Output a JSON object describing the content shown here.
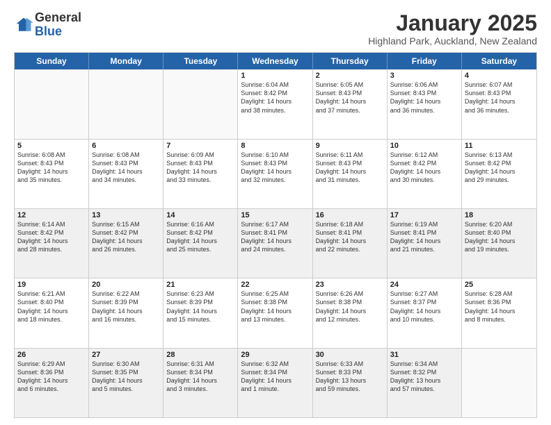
{
  "logo": {
    "general": "General",
    "blue": "Blue"
  },
  "header": {
    "month_title": "January 2025",
    "location": "Highland Park, Auckland, New Zealand"
  },
  "days_of_week": [
    "Sunday",
    "Monday",
    "Tuesday",
    "Wednesday",
    "Thursday",
    "Friday",
    "Saturday"
  ],
  "weeks": [
    [
      {
        "day": "",
        "text": "",
        "empty": true
      },
      {
        "day": "",
        "text": "",
        "empty": true
      },
      {
        "day": "",
        "text": "",
        "empty": true
      },
      {
        "day": "1",
        "text": "Sunrise: 6:04 AM\nSunset: 8:42 PM\nDaylight: 14 hours\nand 38 minutes."
      },
      {
        "day": "2",
        "text": "Sunrise: 6:05 AM\nSunset: 8:43 PM\nDaylight: 14 hours\nand 37 minutes."
      },
      {
        "day": "3",
        "text": "Sunrise: 6:06 AM\nSunset: 8:43 PM\nDaylight: 14 hours\nand 36 minutes."
      },
      {
        "day": "4",
        "text": "Sunrise: 6:07 AM\nSunset: 8:43 PM\nDaylight: 14 hours\nand 36 minutes."
      }
    ],
    [
      {
        "day": "5",
        "text": "Sunrise: 6:08 AM\nSunset: 8:43 PM\nDaylight: 14 hours\nand 35 minutes."
      },
      {
        "day": "6",
        "text": "Sunrise: 6:08 AM\nSunset: 8:43 PM\nDaylight: 14 hours\nand 34 minutes."
      },
      {
        "day": "7",
        "text": "Sunrise: 6:09 AM\nSunset: 8:43 PM\nDaylight: 14 hours\nand 33 minutes."
      },
      {
        "day": "8",
        "text": "Sunrise: 6:10 AM\nSunset: 8:43 PM\nDaylight: 14 hours\nand 32 minutes."
      },
      {
        "day": "9",
        "text": "Sunrise: 6:11 AM\nSunset: 8:43 PM\nDaylight: 14 hours\nand 31 minutes."
      },
      {
        "day": "10",
        "text": "Sunrise: 6:12 AM\nSunset: 8:42 PM\nDaylight: 14 hours\nand 30 minutes."
      },
      {
        "day": "11",
        "text": "Sunrise: 6:13 AM\nSunset: 8:42 PM\nDaylight: 14 hours\nand 29 minutes."
      }
    ],
    [
      {
        "day": "12",
        "text": "Sunrise: 6:14 AM\nSunset: 8:42 PM\nDaylight: 14 hours\nand 28 minutes.",
        "shaded": true
      },
      {
        "day": "13",
        "text": "Sunrise: 6:15 AM\nSunset: 8:42 PM\nDaylight: 14 hours\nand 26 minutes.",
        "shaded": true
      },
      {
        "day": "14",
        "text": "Sunrise: 6:16 AM\nSunset: 8:42 PM\nDaylight: 14 hours\nand 25 minutes.",
        "shaded": true
      },
      {
        "day": "15",
        "text": "Sunrise: 6:17 AM\nSunset: 8:41 PM\nDaylight: 14 hours\nand 24 minutes.",
        "shaded": true
      },
      {
        "day": "16",
        "text": "Sunrise: 6:18 AM\nSunset: 8:41 PM\nDaylight: 14 hours\nand 22 minutes.",
        "shaded": true
      },
      {
        "day": "17",
        "text": "Sunrise: 6:19 AM\nSunset: 8:41 PM\nDaylight: 14 hours\nand 21 minutes.",
        "shaded": true
      },
      {
        "day": "18",
        "text": "Sunrise: 6:20 AM\nSunset: 8:40 PM\nDaylight: 14 hours\nand 19 minutes.",
        "shaded": true
      }
    ],
    [
      {
        "day": "19",
        "text": "Sunrise: 6:21 AM\nSunset: 8:40 PM\nDaylight: 14 hours\nand 18 minutes."
      },
      {
        "day": "20",
        "text": "Sunrise: 6:22 AM\nSunset: 8:39 PM\nDaylight: 14 hours\nand 16 minutes."
      },
      {
        "day": "21",
        "text": "Sunrise: 6:23 AM\nSunset: 8:39 PM\nDaylight: 14 hours\nand 15 minutes."
      },
      {
        "day": "22",
        "text": "Sunrise: 6:25 AM\nSunset: 8:38 PM\nDaylight: 14 hours\nand 13 minutes."
      },
      {
        "day": "23",
        "text": "Sunrise: 6:26 AM\nSunset: 8:38 PM\nDaylight: 14 hours\nand 12 minutes."
      },
      {
        "day": "24",
        "text": "Sunrise: 6:27 AM\nSunset: 8:37 PM\nDaylight: 14 hours\nand 10 minutes."
      },
      {
        "day": "25",
        "text": "Sunrise: 6:28 AM\nSunset: 8:36 PM\nDaylight: 14 hours\nand 8 minutes."
      }
    ],
    [
      {
        "day": "26",
        "text": "Sunrise: 6:29 AM\nSunset: 8:36 PM\nDaylight: 14 hours\nand 6 minutes.",
        "shaded": true
      },
      {
        "day": "27",
        "text": "Sunrise: 6:30 AM\nSunset: 8:35 PM\nDaylight: 14 hours\nand 5 minutes.",
        "shaded": true
      },
      {
        "day": "28",
        "text": "Sunrise: 6:31 AM\nSunset: 8:34 PM\nDaylight: 14 hours\nand 3 minutes.",
        "shaded": true
      },
      {
        "day": "29",
        "text": "Sunrise: 6:32 AM\nSunset: 8:34 PM\nDaylight: 14 hours\nand 1 minute.",
        "shaded": true
      },
      {
        "day": "30",
        "text": "Sunrise: 6:33 AM\nSunset: 8:33 PM\nDaylight: 13 hours\nand 59 minutes.",
        "shaded": true
      },
      {
        "day": "31",
        "text": "Sunrise: 6:34 AM\nSunset: 8:32 PM\nDaylight: 13 hours\nand 57 minutes.",
        "shaded": true
      },
      {
        "day": "",
        "text": "",
        "empty": true,
        "shaded": true
      }
    ]
  ]
}
